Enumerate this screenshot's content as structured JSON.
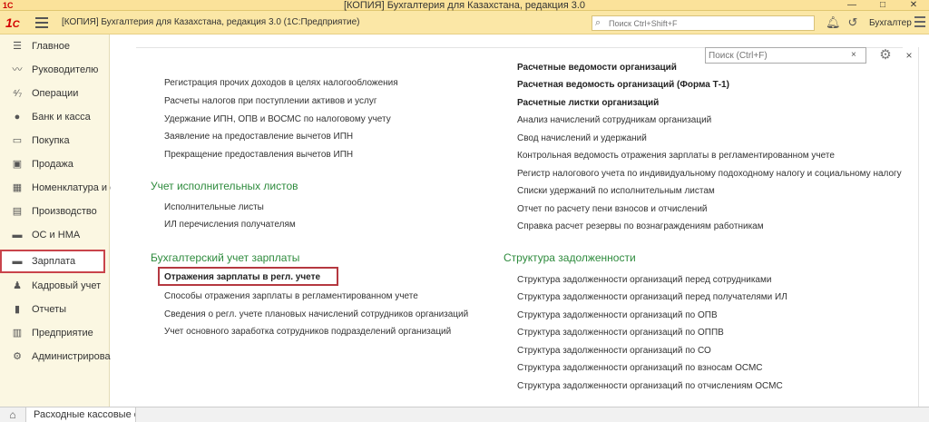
{
  "window": {
    "title": "[КОПИЯ] Бухгалтерия для Казахстана, редакция 3.0",
    "minimize": "—",
    "maximize": "□",
    "close": "✕"
  },
  "app": {
    "title": "[КОПИЯ] Бухгалтерия для Казахстана, редакция 3.0  (1С:Предприятие)",
    "search_placeholder": "Поиск Ctrl+Shift+F",
    "user": "Бухгалтер"
  },
  "sidebar": {
    "items": [
      {
        "label": "Главное",
        "icon": "☰"
      },
      {
        "label": "Руководителю",
        "icon": "〰"
      },
      {
        "label": "Операции",
        "icon": "⁴⁄₇"
      },
      {
        "label": "Банк и касса",
        "icon": "●"
      },
      {
        "label": "Покупка",
        "icon": "▭"
      },
      {
        "label": "Продажа",
        "icon": "▣"
      },
      {
        "label": "Номенклатура и склад",
        "icon": "▦"
      },
      {
        "label": "Производство",
        "icon": "▤"
      },
      {
        "label": "ОС и НМА",
        "icon": "▬"
      },
      {
        "label": "Зарплата",
        "icon": "▬"
      },
      {
        "label": "Кадровый учет",
        "icon": "♟"
      },
      {
        "label": "Отчеты",
        "icon": "▮"
      },
      {
        "label": "Предприятие",
        "icon": "▥"
      },
      {
        "label": "Администрирование",
        "icon": "⚙"
      }
    ]
  },
  "bottombar": {
    "open_tab": "Расходные кассовые ордера"
  },
  "panel": {
    "search_placeholder": "Поиск (Ctrl+F)",
    "search_clear": "×",
    "close": "×",
    "left_top_links": [
      "Регистрация прочих доходов в целях налогообложения",
      "Расчеты налогов при поступлении активов и услуг",
      "Удержание ИПН, ОПВ и ВОСМС по налоговому учету",
      "Заявление на предоставление вычетов ИПН",
      "Прекращение предоставления вычетов ИПН"
    ],
    "group_writs": {
      "title": "Учет исполнительных листов",
      "links": [
        "Исполнительные листы",
        "ИЛ перечисления получателям"
      ]
    },
    "group_acc": {
      "title": "Бухгалтерский учет зарплаты",
      "links": [
        "Отражения зарплаты в регл. учете",
        "Способы отражения зарплаты в регламентированном учете",
        "Сведения о регл. учете плановых начислений сотрудников организаций",
        "Учет основного заработка сотрудников подразделений организаций"
      ]
    },
    "right_top_links": [
      "Расчетные ведомости организаций",
      "Расчетная ведомость организаций (Форма Т-1)",
      "Расчетные листки организаций",
      "Анализ начислений сотрудникам организаций",
      "Свод начислений и удержаний",
      "Контрольная ведомость отражения зарплаты в регламентированном учете",
      "Регистр налогового учета по индивидуальному подоходному налогу и социальному налогу",
      "Списки удержаний по исполнительным листам",
      "Отчет по расчету пени взносов и отчислений",
      "Справка расчет резервы по вознаграждениям работникам"
    ],
    "group_debt": {
      "title": "Структура задолженности",
      "links": [
        "Структура задолженности организаций перед сотрудниками",
        "Структура задолженности организаций перед получателями ИЛ",
        "Структура задолженности организаций по ОПВ",
        "Структура задолженности организаций по ОППВ",
        "Структура задолженности организаций по СО",
        "Структура задолженности организаций по взносам ОСМС",
        "Структура задолженности организаций по отчислениям ОСМС"
      ]
    }
  },
  "colors": {
    "header_bg": "#fbe7a6",
    "sidebar_bg": "#fbf7e2",
    "group_title": "#2e8b3d",
    "highlight": "#b53840"
  }
}
